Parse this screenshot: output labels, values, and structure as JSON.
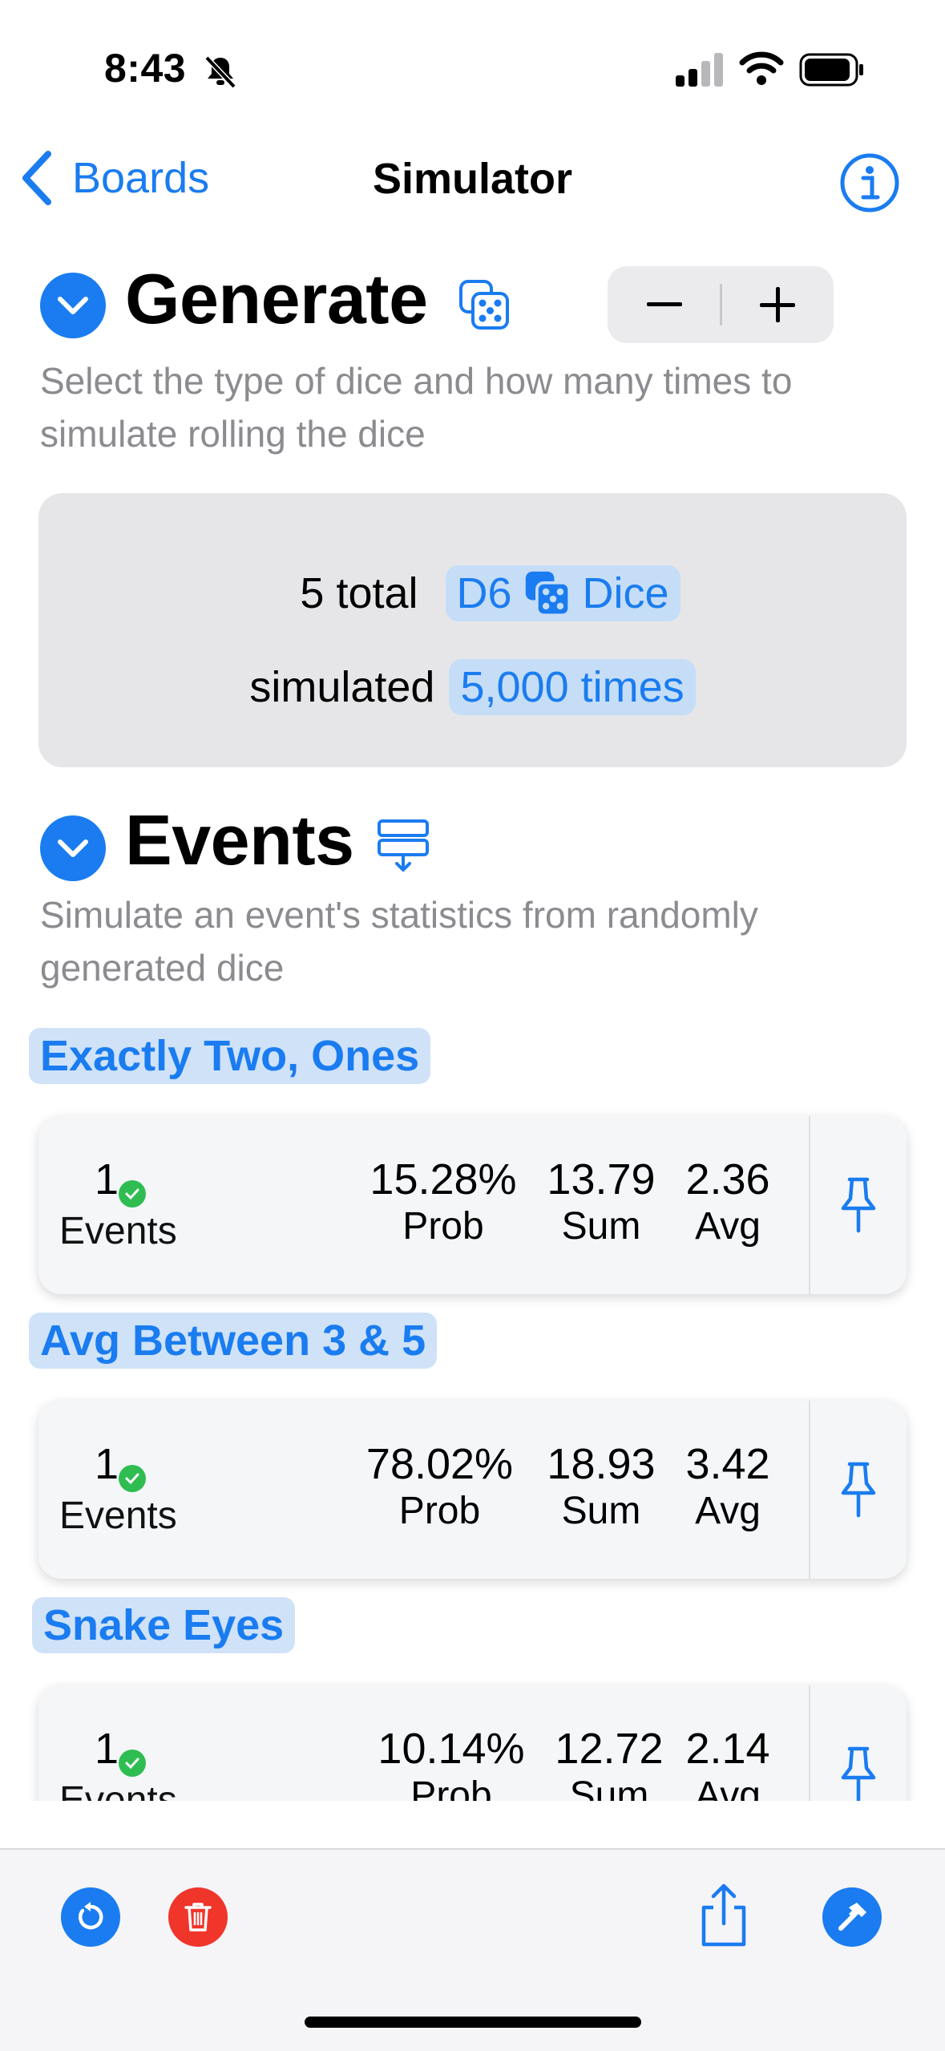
{
  "status_bar": {
    "time": "8:43"
  },
  "nav": {
    "back_label": "Boards",
    "title": "Simulator"
  },
  "generate": {
    "title": "Generate",
    "description": "Select the type of dice and how many times to simulate rolling the dice",
    "count_text": "5 total",
    "dice_type": "D6",
    "dice_label": "Dice",
    "simulated_text": "simulated",
    "times_text": "5,000 times"
  },
  "events_section": {
    "title": "Events",
    "description": "Simulate an event's statistics from randomly generated dice",
    "count_label": "Events",
    "prob_label": "Prob",
    "sum_label": "Sum",
    "avg_label": "Avg",
    "items": [
      {
        "name": "Exactly Two, Ones",
        "count": "1",
        "prob": "15.28%",
        "sum": "13.79",
        "avg": "2.36"
      },
      {
        "name": "Avg Between 3 & 5",
        "count": "1",
        "prob": "78.02%",
        "sum": "18.93",
        "avg": "3.42"
      },
      {
        "name": "Snake Eyes",
        "count": "1",
        "prob": "10.14%",
        "sum": "12.72",
        "avg": "2.14"
      }
    ]
  },
  "colors": {
    "accent": "#1a7cf0",
    "destructive": "#f0352b",
    "success": "#2fbd51"
  }
}
